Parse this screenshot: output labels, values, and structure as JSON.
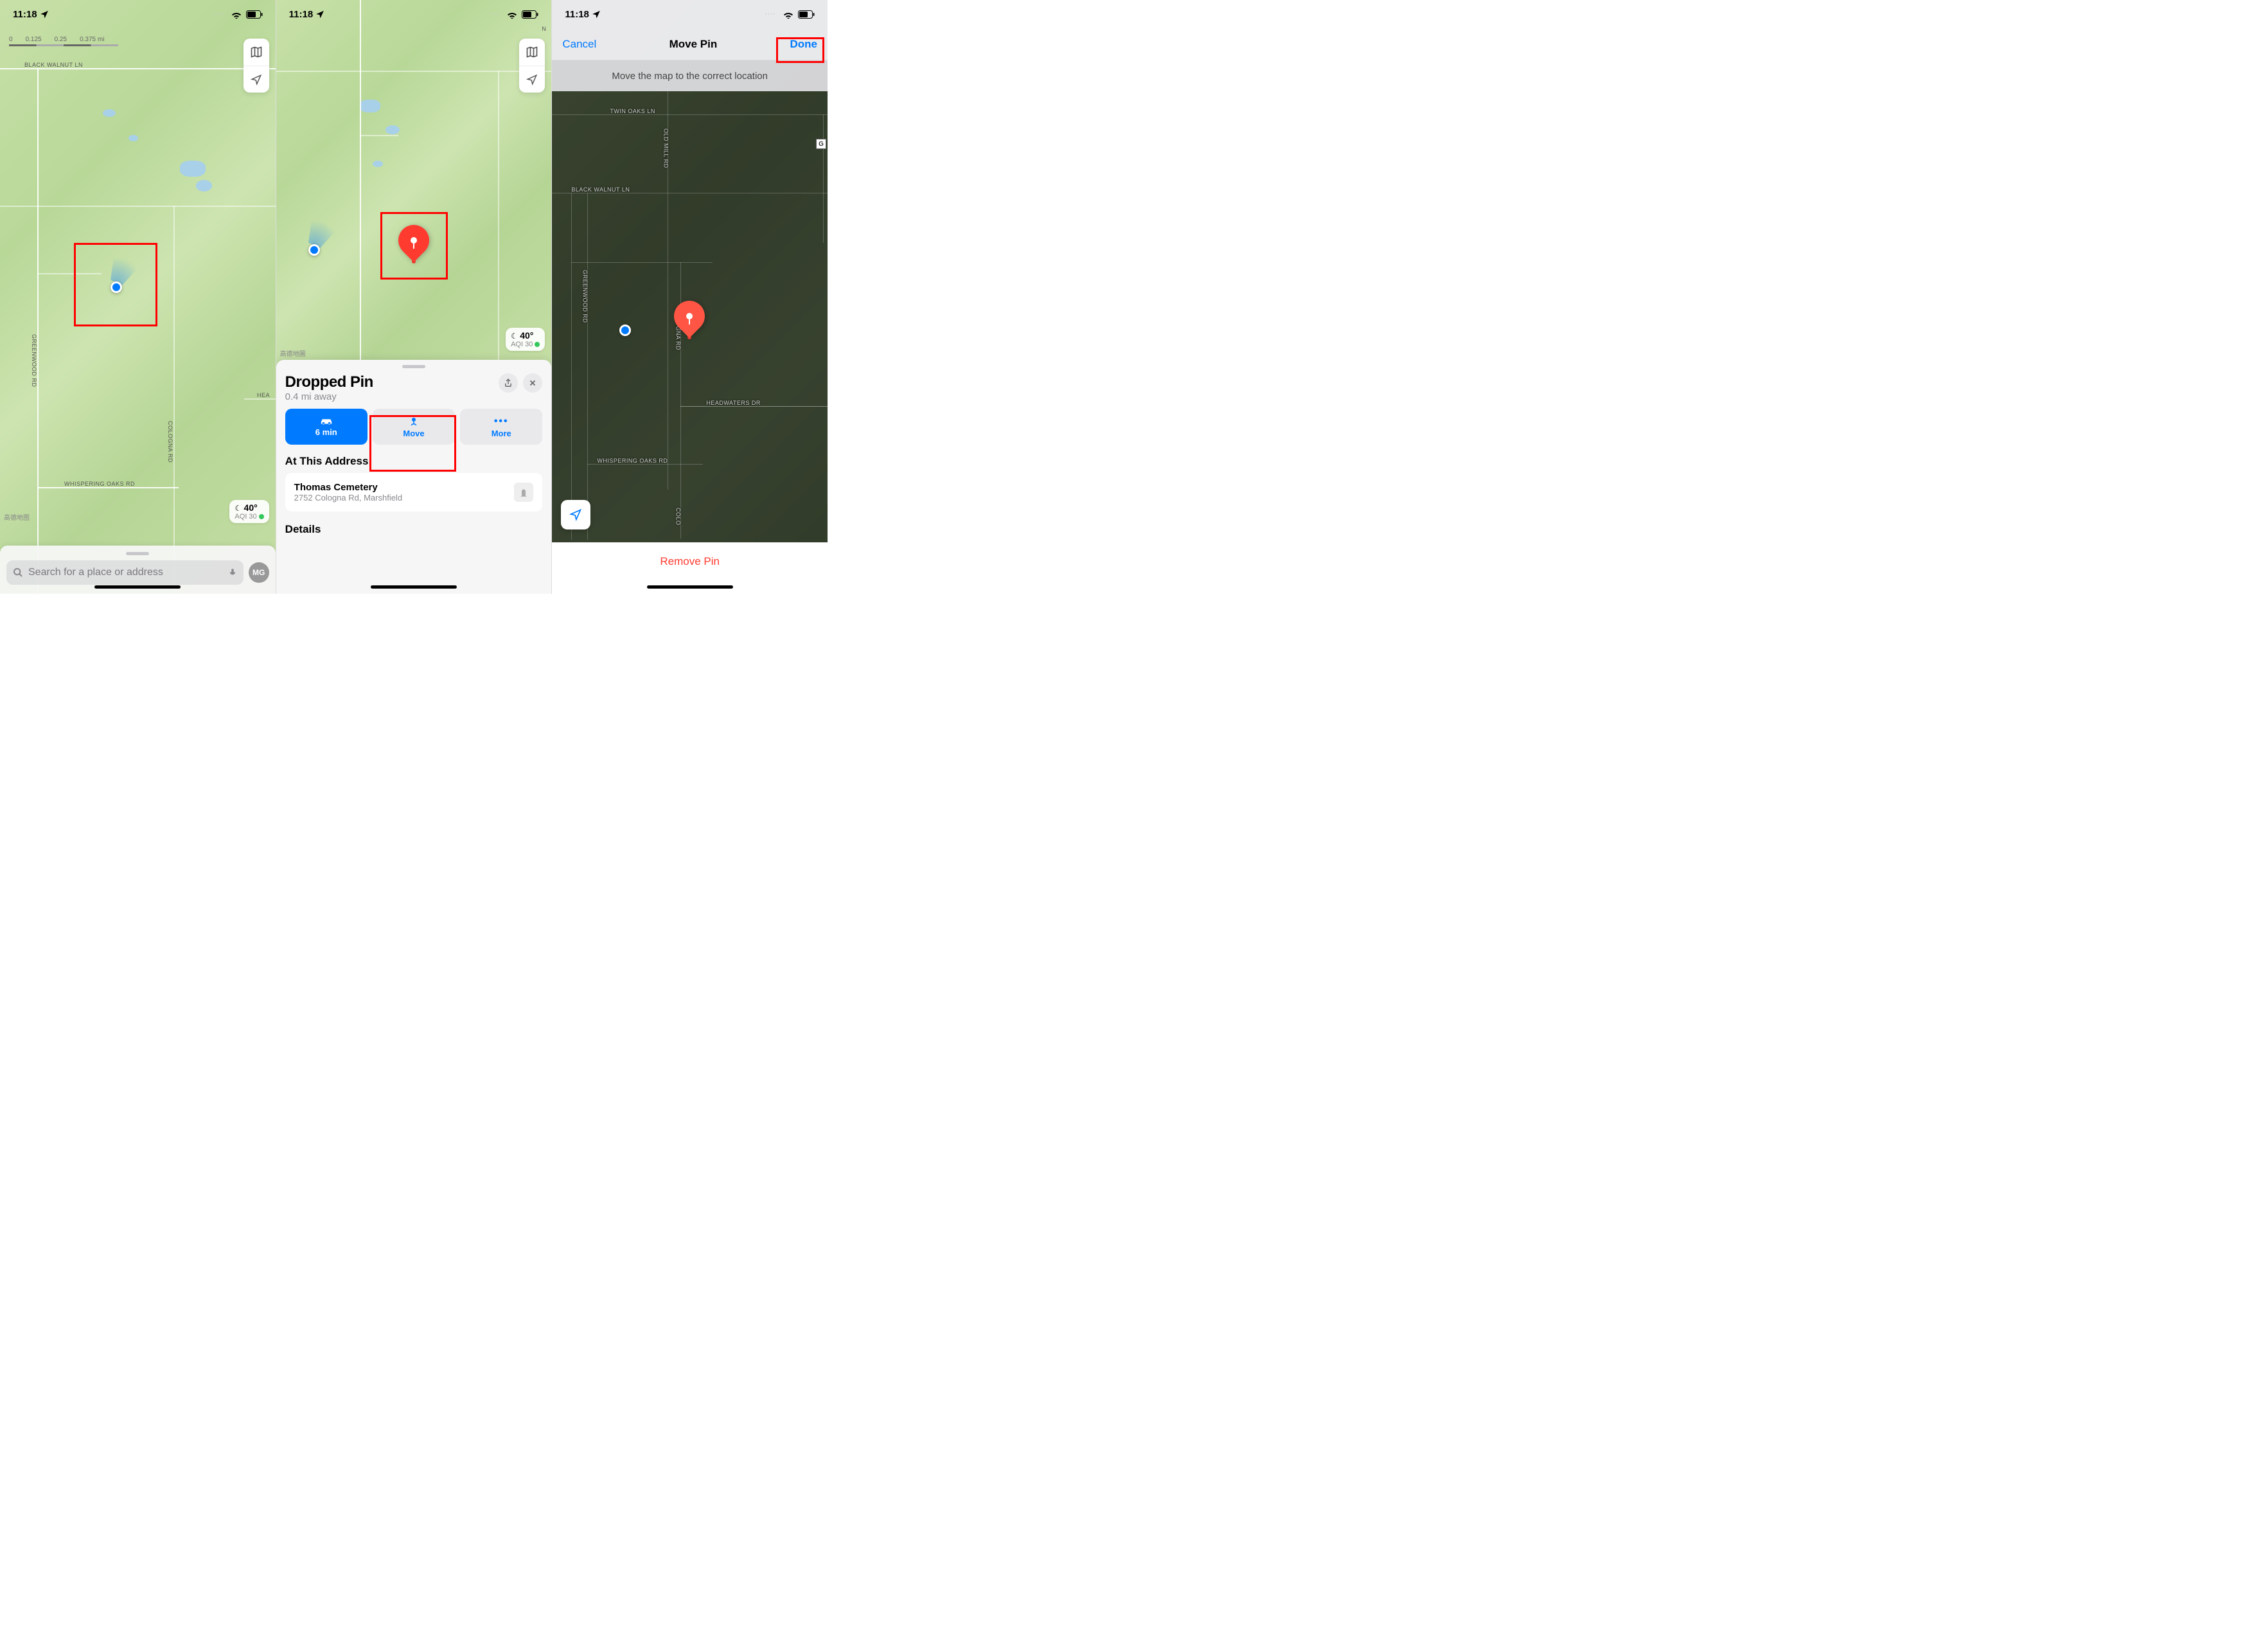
{
  "status": {
    "time": "11:18",
    "dots": "····"
  },
  "screen1": {
    "scale_labels": [
      "0",
      "0.125",
      "0.25",
      "0.375 mi"
    ],
    "roads": {
      "black_walnut": "BLACK WALNUT LN",
      "greenwood": "GREENWOOD RD",
      "cologna": "COLOGNA RD",
      "whispering": "WHISPERING OAKS RD",
      "hea": "HEA"
    },
    "weather": {
      "temp": "40°",
      "aqi": "AQI 30"
    },
    "attribution": "高德地图",
    "search_placeholder": "Search for a place or address",
    "avatar": "MG"
  },
  "screen2": {
    "attribution": "高德地圖",
    "weather": {
      "temp": "40°",
      "aqi": "AQI 30"
    },
    "pin": {
      "title": "Dropped Pin",
      "subtitle": "0.4 mi away"
    },
    "actions": {
      "directions": "6 min",
      "move": "Move",
      "more": "More"
    },
    "section_address": "At This Address",
    "address": {
      "name": "Thomas Cemetery",
      "line": "2752 Cologna Rd, Marshfield"
    },
    "section_details": "Details",
    "road_n": "N"
  },
  "screen3": {
    "nav": {
      "cancel": "Cancel",
      "title": "Move Pin",
      "done": "Done"
    },
    "instruction": "Move the map to the correct location",
    "roads": {
      "twin_oaks": "TWIN OAKS LN",
      "old_mill": "OLD MILL RD",
      "black_walnut": "BLACK WALNUT LN",
      "greenwood": "GREENWOOD RD",
      "cologna_top": "COLOGNA RD",
      "headwaters": "HEADWATERS DR",
      "whispering": "WHISPERING OAKS RD",
      "colo_bottom": "COLO"
    },
    "marker_g": "G",
    "remove": "Remove Pin"
  }
}
